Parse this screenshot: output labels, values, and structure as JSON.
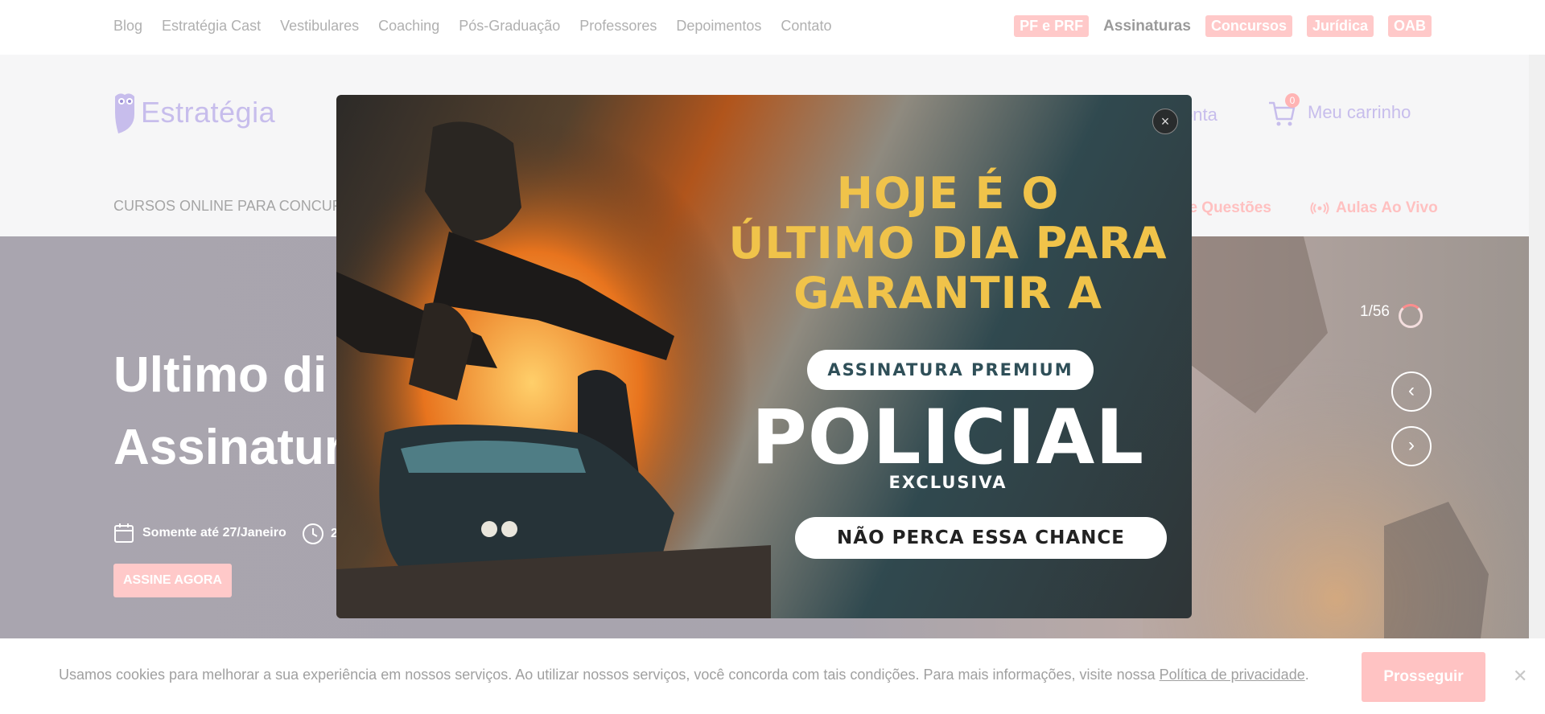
{
  "top_nav": {
    "links": [
      "Blog",
      "Estratégia Cast",
      "Vestibulares",
      "Coaching",
      "Pós-Graduação",
      "Professores",
      "Depoimentos",
      "Contato"
    ],
    "tags": {
      "pf_prf": "PF e PRF",
      "assinaturas": "Assinaturas",
      "concursos": "Concursos",
      "juridica": "Jurídica",
      "oab": "OAB"
    }
  },
  "header": {
    "logo_text": "Estratégia",
    "account_label": "onta",
    "cart_count": "0",
    "cart_label": "Meu carrinho",
    "subnav_left": "CURSOS ONLINE PARA CONCURSO",
    "subnav_questions": "a de Questões",
    "subnav_live": "Aulas Ao Vivo"
  },
  "hero": {
    "title_line1": "Ultimo di",
    "title_line2": "Assinatur",
    "date_text": "Somente até 27/Janeiro",
    "time_text": "2",
    "cta": "ASSINE AGORA",
    "counter": "1/56",
    "prev_arrow": "‹",
    "next_arrow": "›"
  },
  "modal": {
    "headline": [
      "HOJE É O",
      "ÚLTIMO DIA PARA",
      "GARANTIR A"
    ],
    "pill_top": "ASSINATURA PREMIUM",
    "big_word": "POLICIAL",
    "sub_word": "EXCLUSIVA",
    "pill_bottom": "NÃO PERCA ESSA CHANCE",
    "close": "×"
  },
  "cookie": {
    "text": "Usamos cookies para melhorar a sua experiência em nossos serviços. Ao utilizar nossos serviços, você concorda com tais condições. Para mais informações, visite nossa ",
    "link": "Política de privacidade",
    "suffix": ".",
    "button": "Prosseguir",
    "close": "✕"
  },
  "colors": {
    "accent_pink": "#ffc9c9",
    "logo_purple": "#c7bdec",
    "headline_gold": "#f0c34a"
  }
}
